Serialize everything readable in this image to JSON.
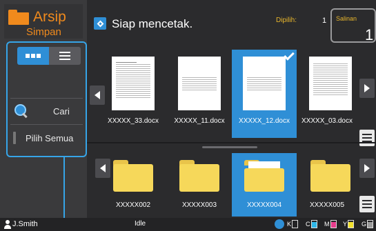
{
  "sidebar": {
    "title": "Arsip",
    "subtitle": "Simpan",
    "view_grid": "grid-view",
    "view_list": "list-view",
    "search_label": "Cari",
    "select_all_label": "Pilih Semua"
  },
  "header": {
    "status": "Siap mencetak.",
    "selected_label": "Dipilih:",
    "selected_count": "1",
    "copies_label": "Salinan",
    "copies_value": "1"
  },
  "documents": [
    {
      "name": "XXXXX_33.docx",
      "selected": false
    },
    {
      "name": "XXXXX_11.docx",
      "selected": false
    },
    {
      "name": "XXXXX_12.docx",
      "selected": true
    },
    {
      "name": "XXXXX_03.docx",
      "selected": false
    }
  ],
  "folders": [
    {
      "name": "XXXXX002",
      "selected": false
    },
    {
      "name": "XXXXX003",
      "selected": false
    },
    {
      "name": "XXXXX004",
      "selected": true
    },
    {
      "name": "XXXXX005",
      "selected": false
    }
  ],
  "statusbar": {
    "user": "J.Smith",
    "state": "Idle",
    "inks": [
      {
        "label": "K",
        "color": "#000000",
        "level": 0.0
      },
      {
        "label": "C",
        "color": "#2fb7e8",
        "level": 0.8
      },
      {
        "label": "M",
        "color": "#e63c8c",
        "level": 0.8
      },
      {
        "label": "Y",
        "color": "#f2e02c",
        "level": 0.8
      },
      {
        "label": "G",
        "color": "#9a9a9a",
        "level": 0.8
      }
    ]
  },
  "colors": {
    "accent": "#2f8fd6",
    "brand_orange": "#f08a1d",
    "label_yellow": "#e8b62d"
  }
}
